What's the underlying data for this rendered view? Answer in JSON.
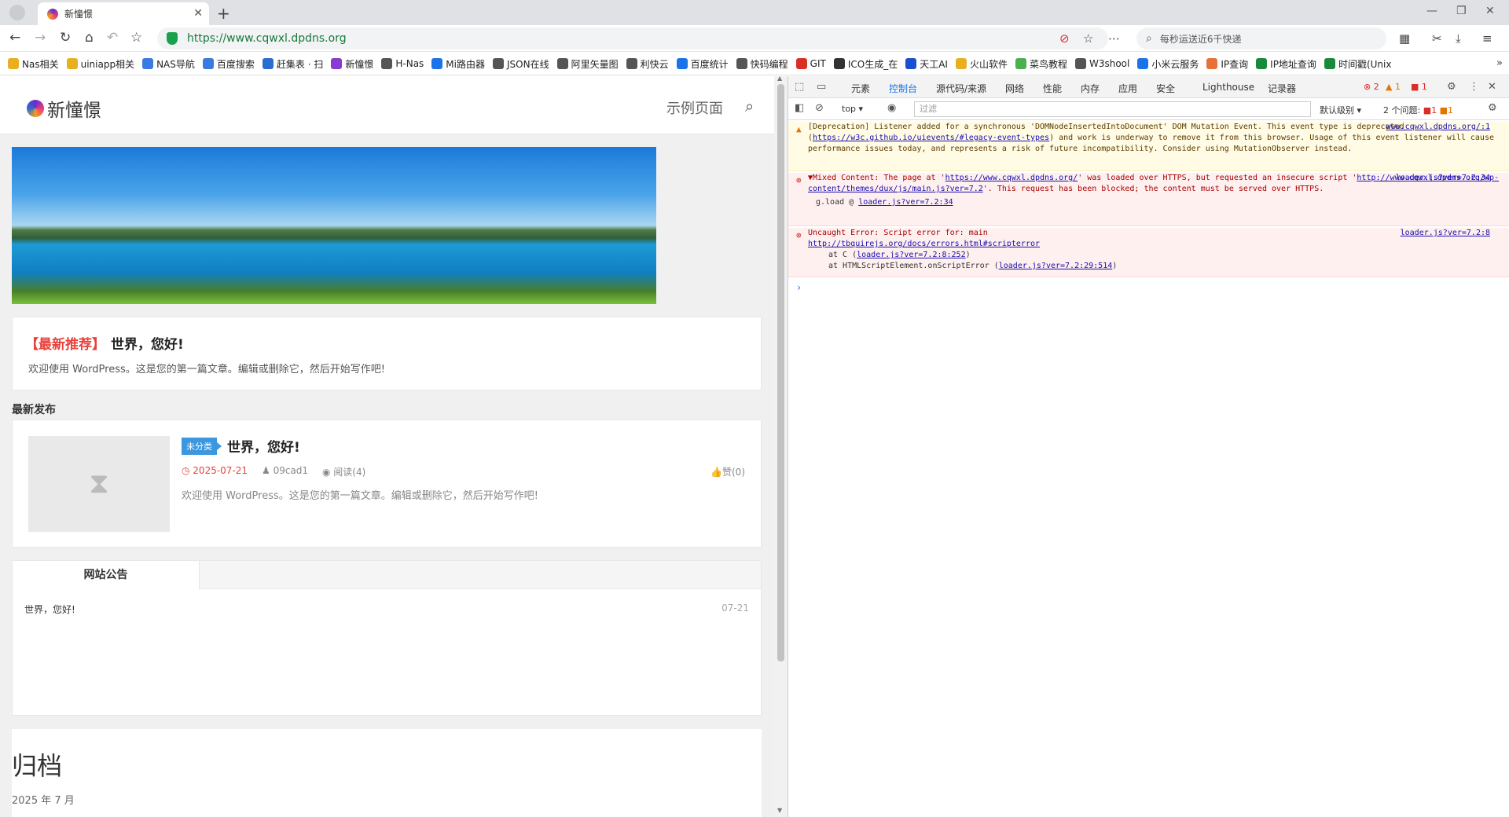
{
  "browser": {
    "tab_title": "新憧憬",
    "url": "https://www.cqwxl.dpdns.org",
    "search_text": "每秒运送近6千快递"
  },
  "bookmarks": [
    "Nas相关",
    "uiniapp相关",
    "NAS导航",
    "百度搜索",
    "赶集表 · 扫",
    "新憧憬",
    "H-Nas",
    "Mi路由器",
    "JSON在线",
    "阿里矢量图",
    "利快云",
    "百度统计",
    "快码编程",
    "GIT",
    "ICO生成_在",
    "天工AI",
    "火山软件",
    "菜鸟教程",
    "W3shool",
    "小米云服务",
    "IP查询",
    "IP地址查询",
    "时间戳(Unix"
  ],
  "site": {
    "logo_text": "新憧憬",
    "nav_link": "示例页面",
    "featured": {
      "tag": "【最新推荐】",
      "title": "世界，您好!",
      "excerpt": "欢迎使用 WordPress。这是您的第一篇文章。编辑或删除它，然后开始写作吧!"
    },
    "latest_heading": "最新发布",
    "post": {
      "category": "未分类",
      "title": "世界，您好!",
      "date": "2025-07-21",
      "author": "09cad1",
      "views": "阅读(4)",
      "likes": "赞(0)",
      "excerpt": "欢迎使用 WordPress。这是您的第一篇文章。编辑或删除它，然后开始写作吧!"
    },
    "notice": {
      "tab": "网站公告",
      "item": "世界，您好!",
      "date": "07-21"
    },
    "archive": {
      "title": "归档",
      "month": "2025 年 7 月"
    }
  },
  "devtools": {
    "tabs": [
      "元素",
      "控制台",
      "源代码/来源",
      "网络",
      "性能",
      "内存",
      "应用",
      "安全",
      "Lighthouse",
      "记录器"
    ],
    "active_tab": "控制台",
    "error_count": "2",
    "warning_count": "1",
    "info_count": "1",
    "context": "top",
    "filter_placeholder": "过滤",
    "levels": "默认级别",
    "issues": "2 个问题:",
    "issues_err": "1",
    "issues_warn": "1",
    "messages": {
      "warn": {
        "text_before": "[Deprecation] Listener added for a synchronous 'DOMNodeInsertedIntoDocument' DOM Mutation Event. This event",
        "text_type": "type is deprecated (",
        "link": "https://w3c.github.io/uievents/#legacy-event-types",
        "text_after": ") and work is underway to remove it from this browser. Usage of this event listener will cause performance issues today, and represents a risk of future incompatibility. Consider using MutationObserver instead.",
        "src": "www.cqwxl.dpdns.org/:1"
      },
      "err1": {
        "text1": "▼Mixed Content: The page at '",
        "link1": "https://www.cqwxl.dpdns.org/",
        "text2": "' was loaded over HTTPS, but requested an insecure script '",
        "link2": "http://www.cqwxl.dpdns.org/wp-content/themes/dux/js/main.js?ver=7.2",
        "text3": "'. This request has been blocked; the content must be served over HTTPS.",
        "stack": "g.load @",
        "stack_link": "loader.js?ver=7.2:34",
        "src": "loader.js?ver=7.2:34"
      },
      "err2": {
        "text": "Uncaught Error: Script error for: main",
        "link": "http://tbquirejs.org/docs/errors.html#scripterror",
        "stack1": "at C (",
        "stack1_link": "loader.js?ver=7.2:8:252",
        "stack2": "at HTMLScriptElement.onScriptError (",
        "stack2_link": "loader.js?ver=7.2:29:514",
        "src": "loader.js?ver=7.2:8"
      }
    }
  }
}
